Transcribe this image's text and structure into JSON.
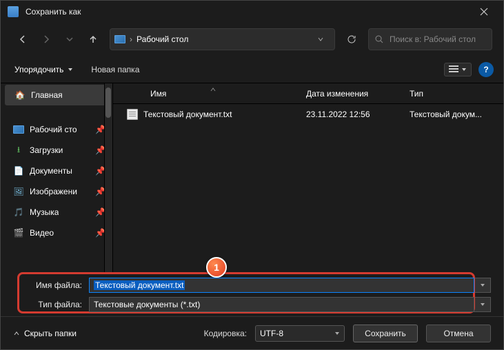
{
  "title": "Сохранить как",
  "path": {
    "location": "Рабочий стол"
  },
  "search": {
    "placeholder": "Поиск в: Рабочий стол"
  },
  "toolbar": {
    "organize": "Упорядочить",
    "newFolder": "Новая папка"
  },
  "sidebar": {
    "home": "Главная",
    "items": [
      {
        "label": "Рабочий сто"
      },
      {
        "label": "Загрузки"
      },
      {
        "label": "Документы"
      },
      {
        "label": "Изображени"
      },
      {
        "label": "Музыка"
      },
      {
        "label": "Видео"
      }
    ]
  },
  "columns": {
    "name": "Имя",
    "date": "Дата изменения",
    "type": "Тип"
  },
  "files": [
    {
      "name": "Текстовый документ.txt",
      "date": "23.11.2022 12:56",
      "type": "Текстовый докум..."
    }
  ],
  "form": {
    "filenameLabel": "Имя файла:",
    "filename": "Текстовый документ.txt",
    "filetypeLabel": "Тип файла:",
    "filetype": "Текстовые документы (*.txt)",
    "encodingLabel": "Кодировка:",
    "encoding": "UTF-8",
    "save": "Сохранить",
    "cancel": "Отмена",
    "hideFolders": "Скрыть папки"
  },
  "annotation": {
    "step": "1"
  }
}
